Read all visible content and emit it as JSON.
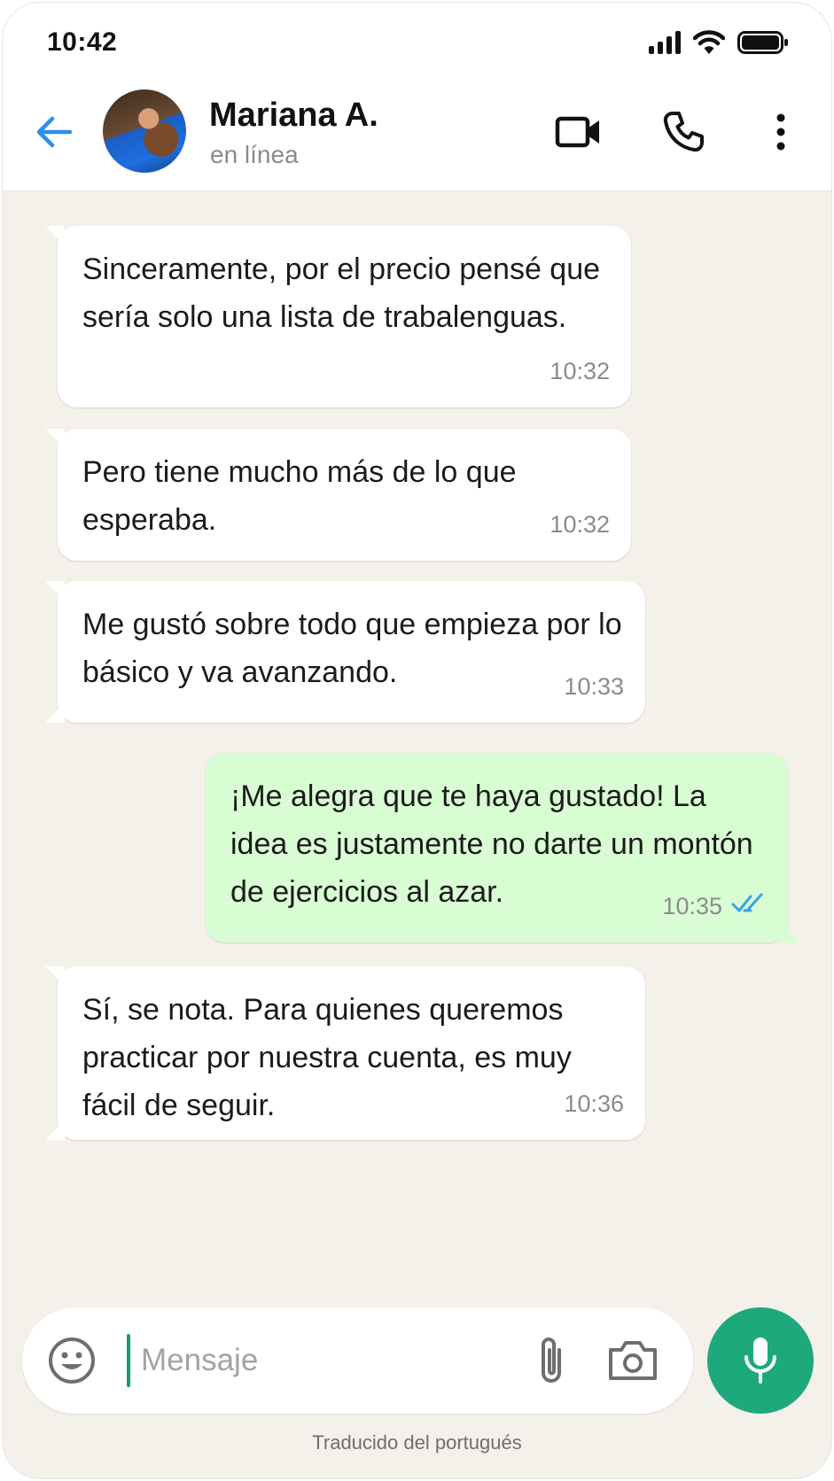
{
  "status_bar": {
    "time": "10:42"
  },
  "header": {
    "contact_name": "Mariana A.",
    "contact_status": "en línea"
  },
  "messages": [
    {
      "direction": "in",
      "text": "Sinceramente, por el precio pensé que sería solo una lista de trabalenguas.",
      "time": "10:32"
    },
    {
      "direction": "in",
      "text": "Pero tiene mucho más de lo que esperaba.",
      "time": "10:32"
    },
    {
      "direction": "in",
      "text": "Me gustó sobre todo que empieza por lo básico y va avanzando.",
      "time": "10:33"
    },
    {
      "direction": "out",
      "text": "¡Me alegra que te haya gustado! La idea es justamente no darte un montón de ejercicios al azar.",
      "time": "10:35",
      "read": true
    },
    {
      "direction": "in",
      "text": "Sí, se nota. Para quienes queremos practicar por nuestra cuenta, es muy fácil de seguir.",
      "time": "10:36"
    }
  ],
  "composer": {
    "placeholder": "Mensaje",
    "value": ""
  },
  "footer": {
    "note": "Traducido del portugués"
  },
  "colors": {
    "accent": "#1ea97c",
    "outgoing_bubble": "#d9fdd3",
    "chat_background": "#f4f0ea",
    "read_ticks": "#34a3e8",
    "back_arrow": "#2b8ff0"
  },
  "icons": [
    "back-arrow-icon",
    "video-call-icon",
    "phone-call-icon",
    "more-options-icon",
    "emoji-icon",
    "attach-icon",
    "camera-icon",
    "mic-icon",
    "double-check-icon"
  ]
}
